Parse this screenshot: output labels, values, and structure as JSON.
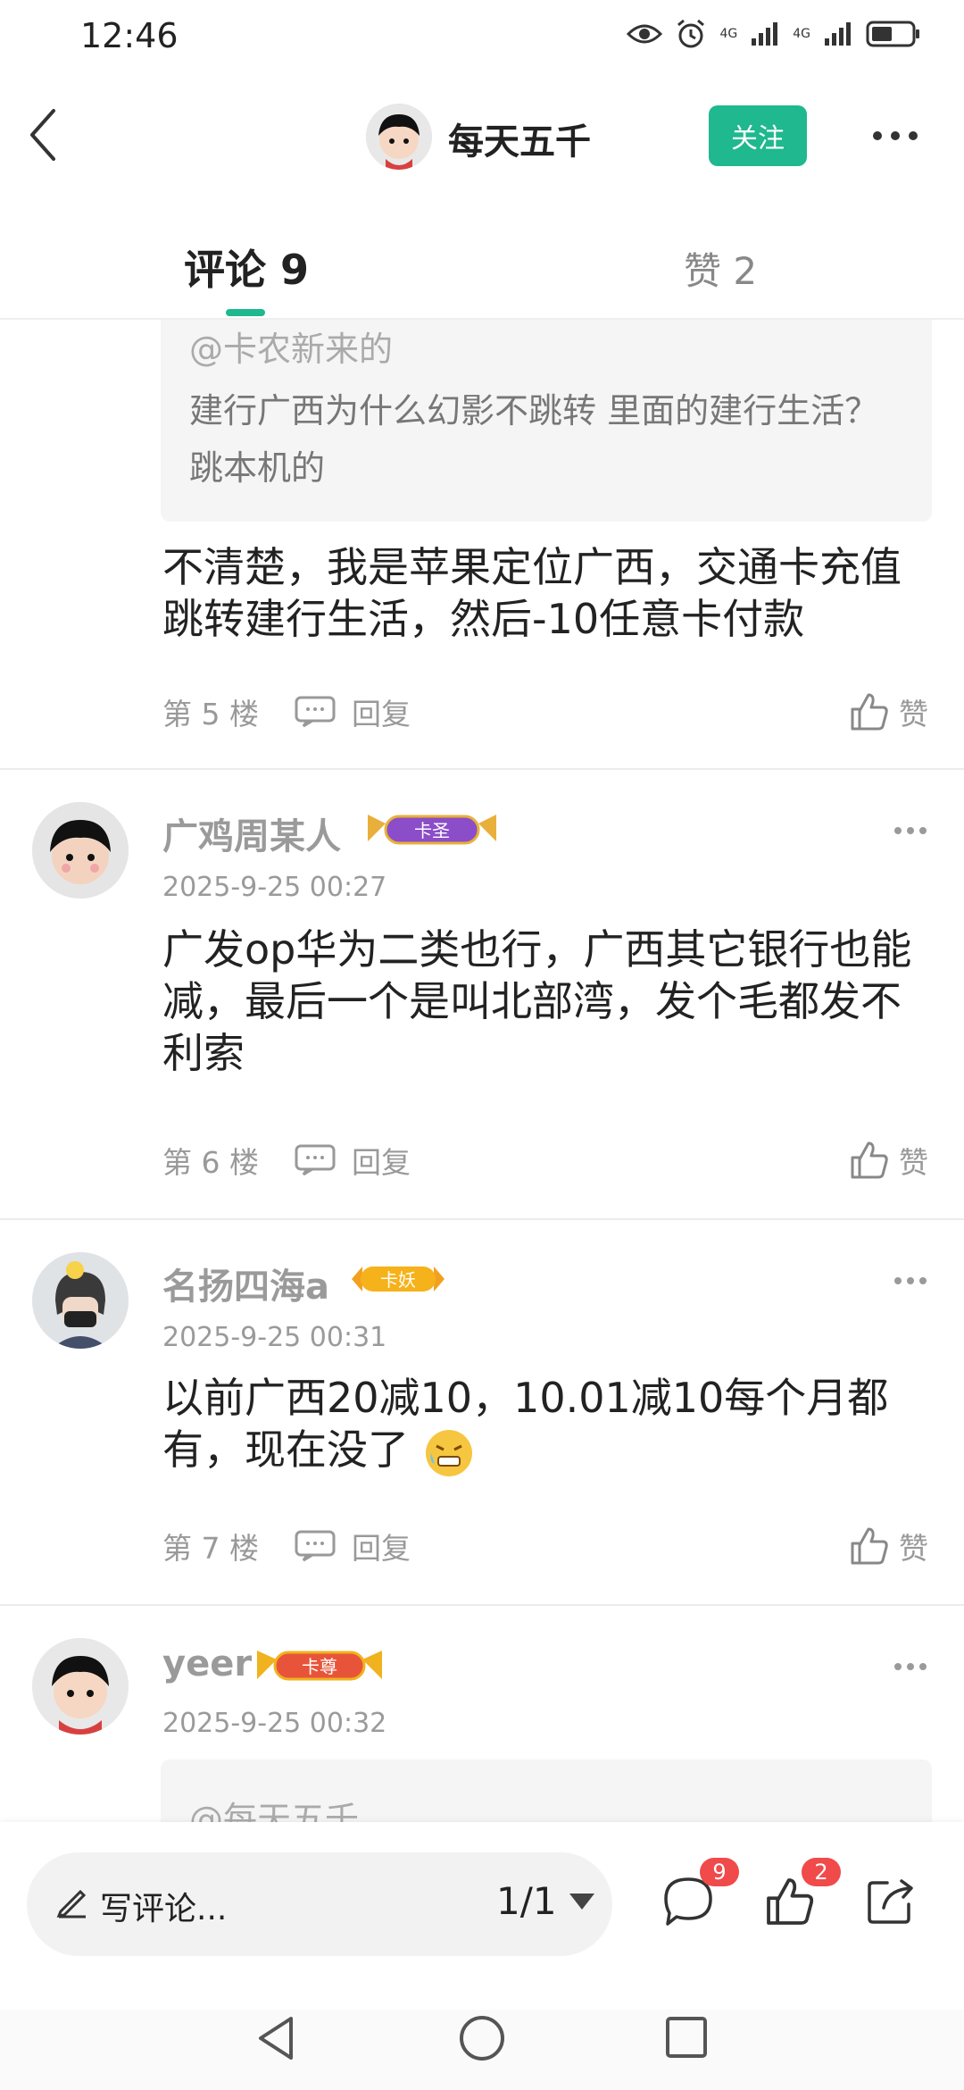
{
  "status_bar": {
    "time": "12:46",
    "signal1": "4G",
    "signal2": "4G"
  },
  "header": {
    "title": "每天五千",
    "follow_label": "关注"
  },
  "tabs": {
    "comments": "评论 9",
    "likes": "赞 2"
  },
  "comments": [
    {
      "quote_user": "@卡农新来的",
      "quote_text": "建行广西为什么幻影不跳转 里面的建行生活？　跳本机的",
      "text": "不清楚，我是苹果定位广西，交通卡充值跳转建行生活，然后-10任意卡付款",
      "floor": "第 5 楼",
      "reply": "回复",
      "like": "赞"
    },
    {
      "user": "广鸡周某人",
      "badge": "卡圣",
      "date": "2025-9-25 00:27",
      "text": "广发op华为二类也行，广西其它银行也能减，最后一个是叫北部湾，发个毛都发不利索",
      "floor": "第 6 楼",
      "reply": "回复",
      "like": "赞"
    },
    {
      "user": "名扬四海a",
      "badge": "卡妖",
      "date": "2025-9-25 00:31",
      "text": "以前广西20减10，10.01减10每个月都有，现在没了",
      "floor": "第 7 楼",
      "reply": "回复",
      "like": "赞"
    },
    {
      "user": "yeer",
      "badge": "卡尊",
      "date": "2025-9-25 00:32",
      "quote_user": "@每天五千"
    }
  ],
  "bottom_bar": {
    "write_placeholder": "写评论...",
    "page_indicator": "1/1",
    "comment_count": "9",
    "like_count": "2"
  },
  "colors": {
    "accent": "#1fb88f",
    "badge_red": "#f04a4a"
  }
}
